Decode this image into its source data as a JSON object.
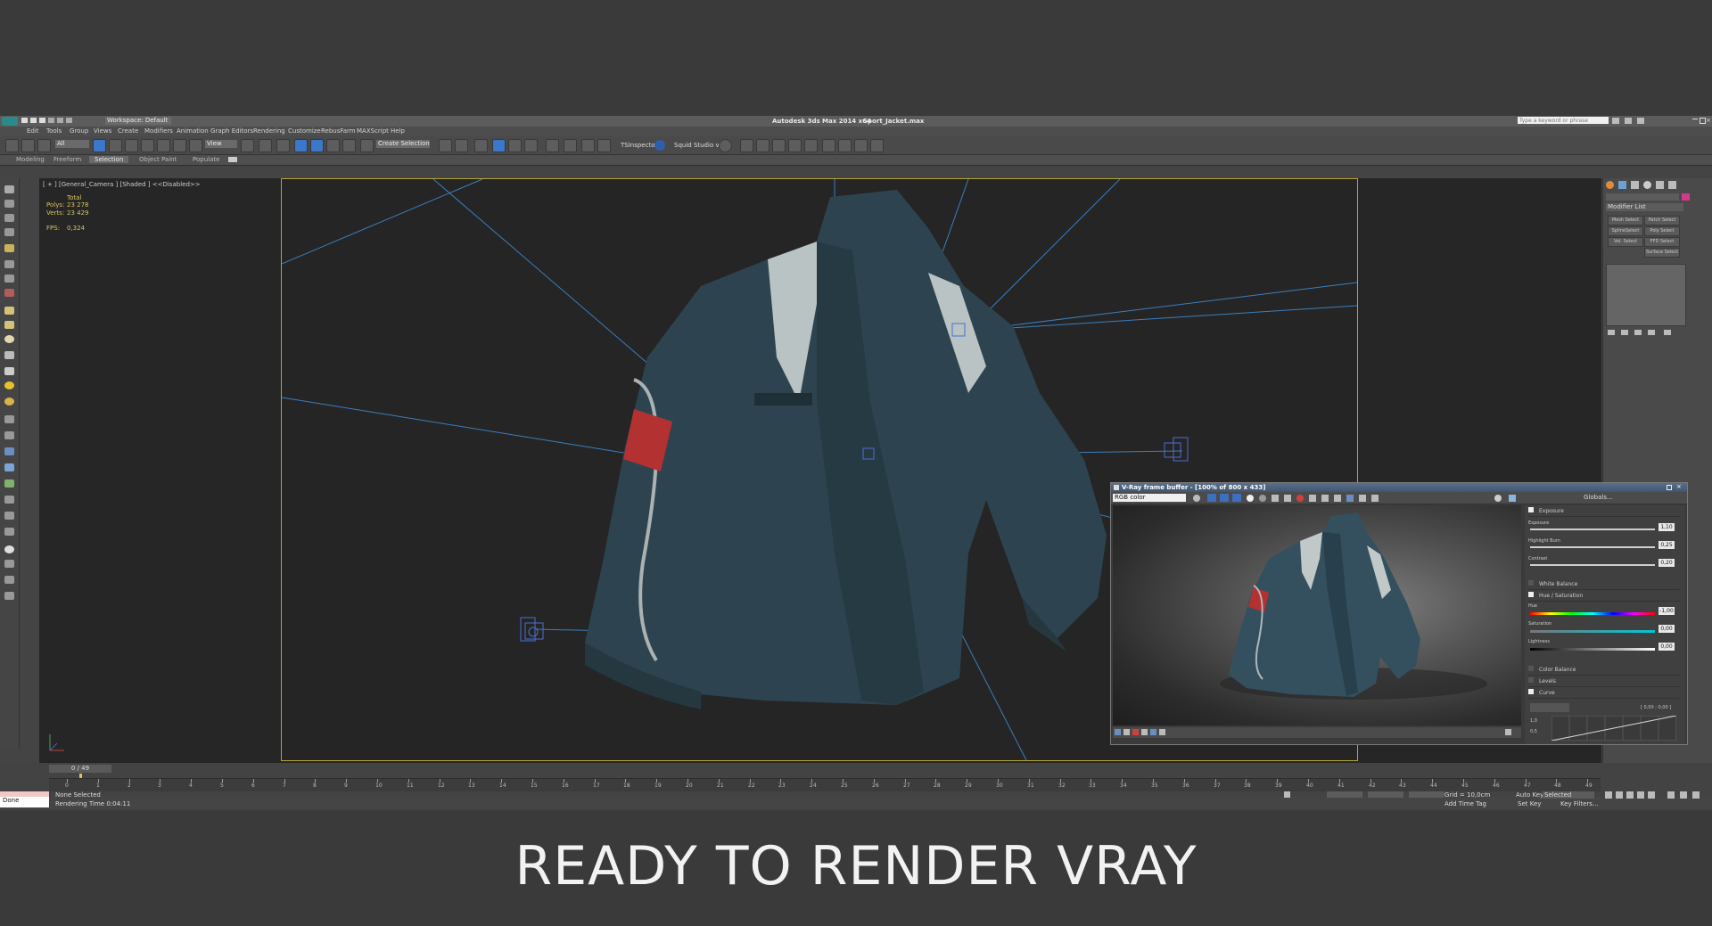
{
  "title": {
    "workspace": "Workspace: Default",
    "app": "Autodesk 3ds Max  2014 x64",
    "file": "Sport_Jacket.max",
    "search_placeholder": "Type a keyword or phrase"
  },
  "menu": [
    "Edit",
    "Tools",
    "Group",
    "Views",
    "Create",
    "Modifiers",
    "Animation",
    "Graph Editors",
    "Rendering",
    "Customize",
    "RebusFarm",
    "MAXScript",
    "Help"
  ],
  "toolbar": {
    "filter": "All",
    "refcoord": "View",
    "selection_set": "Create Selection Se",
    "tsinspector": "TSInspector",
    "squid": "Squid Studio v"
  },
  "ribbon": [
    "Modeling",
    "Freeform",
    "Selection",
    "Object Paint",
    "Populate"
  ],
  "viewport": {
    "label": "[ + ] [General_Camera ] [Shaded ]  <<Disabled>>",
    "stats_total": "Total",
    "polys_label": "Polys:",
    "polys_value": "23 278",
    "verts_label": "Verts:",
    "verts_value": "23 429",
    "fps_label": "FPS:",
    "fps_value": "0,324"
  },
  "command_panel": {
    "modifier_list": "Modifier List",
    "buttons": [
      "Mesh Select",
      "Patch Select",
      "SplineSelect",
      "Poly Select",
      "Vol. Select",
      "FFD Select",
      "Surface Select"
    ]
  },
  "timeline": {
    "frame_counter": "0 / 49",
    "ticks": [
      "0",
      "1",
      "2",
      "3",
      "4",
      "5",
      "6",
      "7",
      "8",
      "9",
      "10",
      "11",
      "12",
      "13",
      "14",
      "15",
      "16",
      "17",
      "18",
      "19",
      "20",
      "21",
      "22",
      "23",
      "24",
      "25",
      "26",
      "27",
      "28",
      "29",
      "30",
      "31",
      "32",
      "33",
      "34",
      "35",
      "36",
      "37",
      "38",
      "39",
      "40",
      "41",
      "42",
      "43",
      "44",
      "45",
      "46",
      "47",
      "48",
      "49"
    ]
  },
  "status": {
    "selection": "None Selected",
    "rendering_time": "Rendering Time  0:04:11",
    "listener": "Done",
    "grid": "Grid = 10,0cm",
    "add_time_tag": "Add Time Tag",
    "auto_key": "Auto Key",
    "auto_key_value": "Selected",
    "set_key": "Set Key",
    "key_filters": "Key Filters..."
  },
  "vfb": {
    "title": "V-Ray frame buffer - [100% of 800 x 433]",
    "channel": "RGB color",
    "globals": "Globals...",
    "exposure_section": "Exposure",
    "exposure_label": "Exposure",
    "exposure_value": "1,10",
    "highlight_label": "Highlight Burn",
    "highlight_value": "0,25",
    "contrast_label": "Contrast",
    "contrast_value": "0,20",
    "white_balance": "White Balance",
    "hue_sat": "Hue / Saturation",
    "hue_label": "Hue",
    "hue_value": "-1,00",
    "saturation_label": "Saturation",
    "saturation_value": "0,00",
    "lightness_label": "Lightness",
    "lightness_value": "0,00",
    "color_balance": "Color Balance",
    "levels": "Levels",
    "curve": "Curve",
    "curve_readout": "[ 0,00 ; 0,00 ]",
    "curve_max": "1,0",
    "curve_mid": "0,5"
  },
  "caption": "READY TO RENDER  VRAY",
  "colors": {
    "accent": "#3b78c9",
    "safe_frame": "#b6a43a",
    "jacket": "#2d4450",
    "patch": "#b33131"
  }
}
